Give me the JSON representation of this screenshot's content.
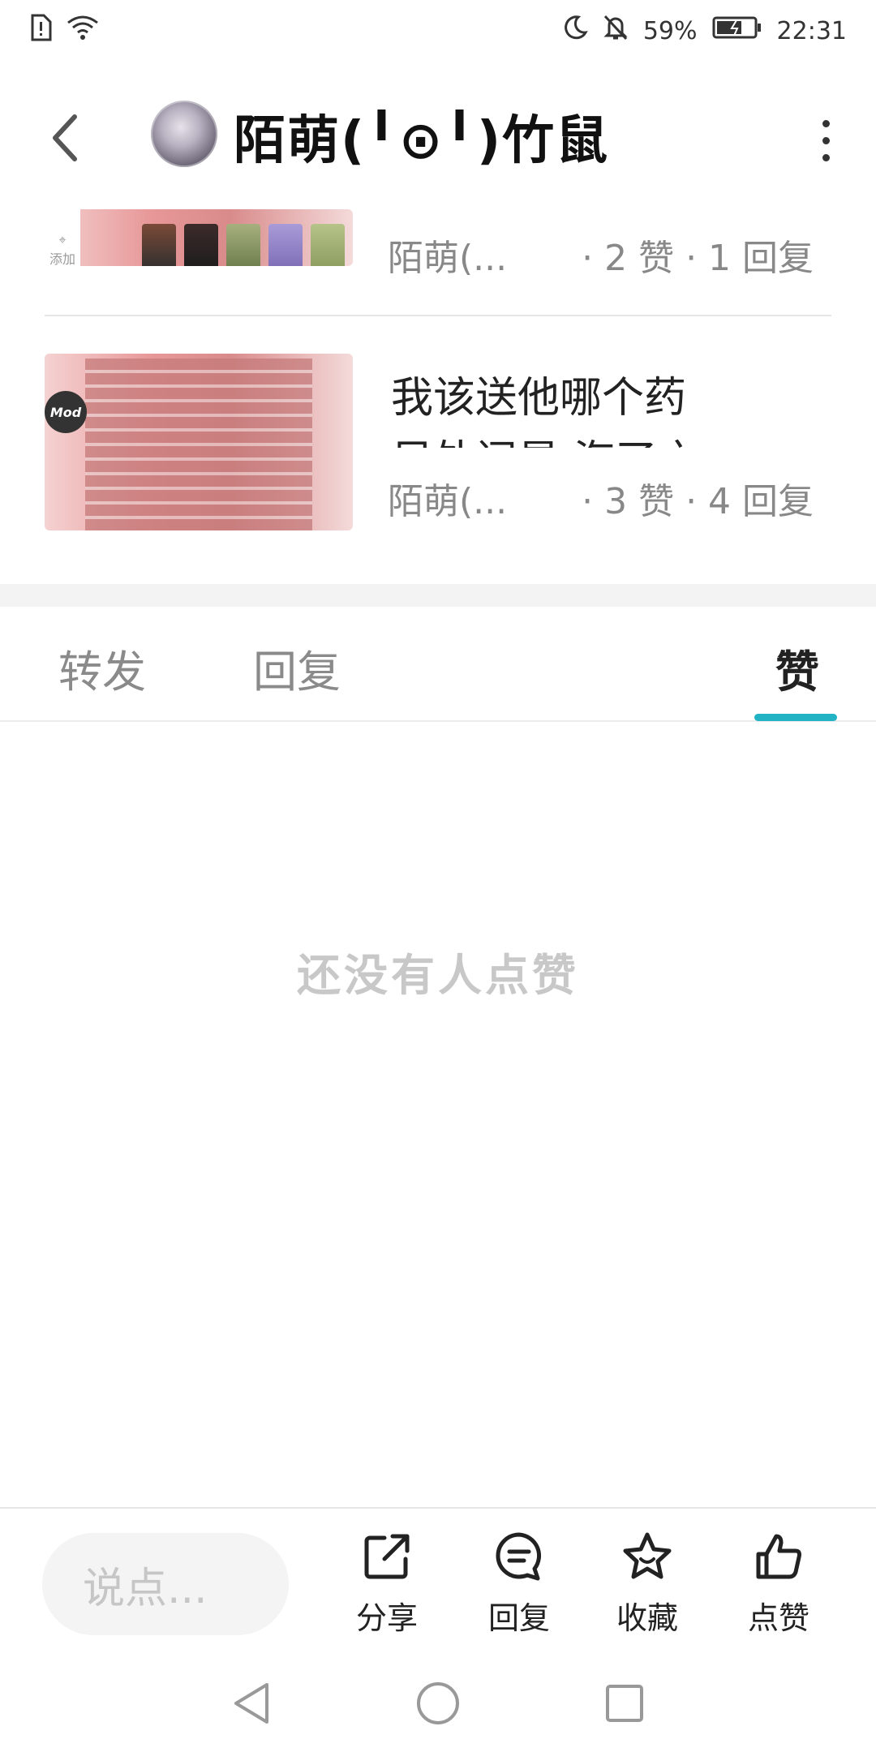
{
  "status_bar": {
    "battery": "59%",
    "time": "22:31"
  },
  "header": {
    "title": "陌萌(╹⊙╹)竹鼠"
  },
  "posts": [
    {
      "title": "",
      "author": "陌萌(...",
      "stats": "· 2 赞 · 1 回复",
      "thumb_add_label": "添加"
    },
    {
      "title": "我该送他哪个药",
      "title_line2": "另外问是 海了之",
      "author": "陌萌(...",
      "stats": "· 3 赞 · 4 回复",
      "badge": "Mod"
    }
  ],
  "tabs": [
    {
      "label": "转发",
      "active": false
    },
    {
      "label": "回复",
      "active": false
    },
    {
      "label": "赞",
      "active": true
    }
  ],
  "empty_state": "还没有人点赞",
  "action_bar": {
    "comment_placeholder": "说点...",
    "share": "分享",
    "reply": "回复",
    "favorite": "收藏",
    "like": "点赞"
  },
  "colors": {
    "accent": "#22b3c4",
    "text_primary": "#222222",
    "text_secondary": "#888888",
    "empty_text": "#c8c8c8"
  }
}
